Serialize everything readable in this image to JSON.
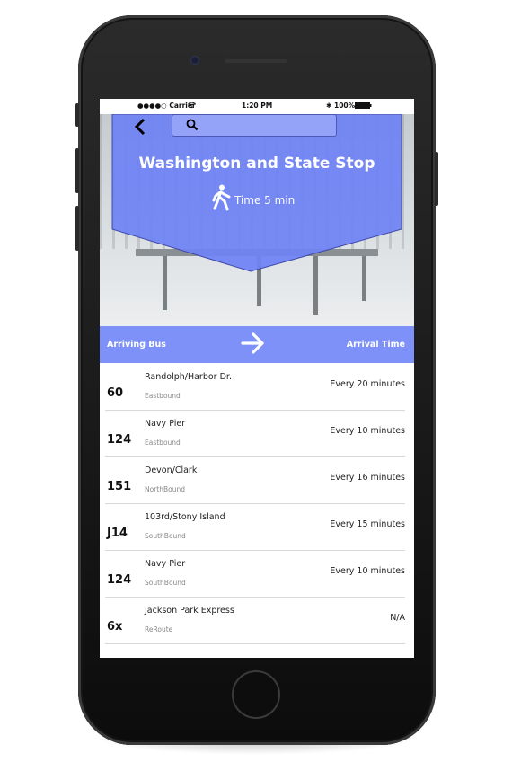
{
  "status_bar": {
    "carrier": "●●●●○ Carrier",
    "time": "1:20 PM",
    "battery": "100%"
  },
  "stop": {
    "title": "Washington and State Stop",
    "walk_time": "Time 5 min"
  },
  "icons": {
    "back": "back-chevron-icon",
    "search": "search-icon",
    "walk": "walking-person-icon",
    "arrow": "right-arrow-icon"
  },
  "colors": {
    "accent": "#7d91f9",
    "banner": "#6f82f4"
  },
  "list_header": {
    "left": "Arriving Bus",
    "right": "Arrival Time"
  },
  "routes": [
    {
      "number": "60",
      "name": "Randolph/Harbor Dr.",
      "direction": "Eastbound",
      "arrival": "Every 20 minutes"
    },
    {
      "number": "124",
      "name": "Navy Pier",
      "direction": "Eastbound",
      "arrival": "Every 10 minutes"
    },
    {
      "number": "151",
      "name": "Devon/Clark",
      "direction": "NorthBound",
      "arrival": "Every 16 minutes"
    },
    {
      "number": "J14",
      "name": "103rd/Stony Island",
      "direction": "SouthBound",
      "arrival": "Every 15 minutes"
    },
    {
      "number": "124",
      "name": "Navy Pier",
      "direction": "SouthBound",
      "arrival": "Every 10 minutes"
    },
    {
      "number": "6x",
      "name": "Jackson Park Express",
      "direction": "ReRoute",
      "arrival": "N/A"
    }
  ]
}
